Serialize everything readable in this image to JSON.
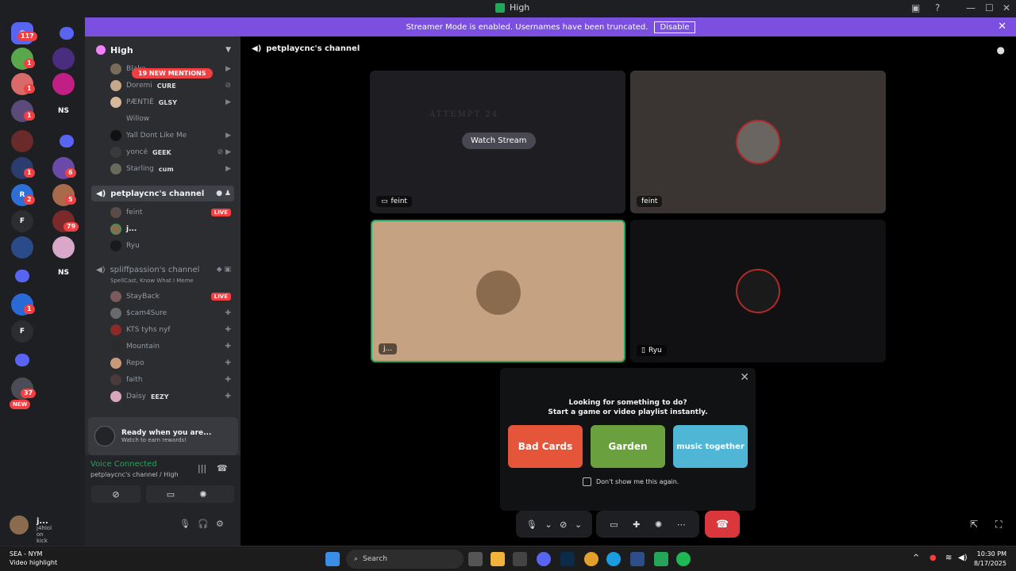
{
  "window": {
    "title": "High"
  },
  "banner": {
    "text": "Streamer Mode is enabled. Usernames have been truncated.",
    "button": "Disable"
  },
  "rail": {
    "badges": {
      "dm": "117",
      "new": "NEW",
      "count37": "37",
      "b1": "1",
      "b6": "6",
      "b5": "5",
      "b2": "2",
      "b79": "79"
    },
    "labels": {
      "ns": "NS",
      "ns2": "NS",
      "ns3": "NS",
      "f": "F",
      "f2": "F",
      "r": "R"
    }
  },
  "guild": {
    "name": "High"
  },
  "channels": {
    "mentions": "19 NEW MENTIONS",
    "top_members": [
      {
        "name": "Blake",
        "tag": ""
      },
      {
        "name": "Doremi",
        "tag": "CURE"
      },
      {
        "name": "PÆNTIÈ",
        "tag": "GLSY"
      },
      {
        "name": "Willow",
        "tag": ""
      },
      {
        "name": "Yall Dont Like Me",
        "tag": ""
      },
      {
        "name": "yoncé",
        "tag": "GEEK"
      },
      {
        "name": "Starling",
        "tag": "cum"
      }
    ],
    "active_channel": "petplaycnc's channel",
    "active_members": [
      {
        "name": "feint",
        "badge": "LIVE"
      },
      {
        "name": "j...",
        "badge": ""
      },
      {
        "name": "Ryu",
        "badge": ""
      }
    ],
    "second_channel": "spliffpassion's channel",
    "second_channel_status": "SpellCast, Know What I Meme",
    "second_members": [
      {
        "name": "StayBack",
        "badge": "LIVE"
      },
      {
        "name": "$cam4Sure",
        "badge": ""
      },
      {
        "name": "KTS tyhs nyf",
        "badge": ""
      },
      {
        "name": "Mountain",
        "badge": ""
      },
      {
        "name": "Repo",
        "badge": ""
      },
      {
        "name": "faith",
        "badge": ""
      },
      {
        "name": "Daisy",
        "tag": "EEZY"
      }
    ]
  },
  "promo": {
    "title": "Ready when you are...",
    "subtitle": "Watch to earn rewards!"
  },
  "voice": {
    "status": "Voice Connected",
    "channel": "petplaycnc's channel / High"
  },
  "user": {
    "name": "j...",
    "status": "j4hlol on kick"
  },
  "main": {
    "channel_title": "petplaycnc's channel",
    "tiles": [
      {
        "label": "feint",
        "watch": "Watch Stream",
        "ghost": "ATTEMPT 24"
      },
      {
        "label": "feint"
      },
      {
        "label": "j..."
      },
      {
        "label": "Ryu"
      }
    ]
  },
  "activity": {
    "line1": "Looking for something to do?",
    "line2": "Start a game or video playlist instantly.",
    "cards": [
      {
        "label": "Bad Cards",
        "color": "#e4553a"
      },
      {
        "label": "Garden",
        "color": "#6aa13e"
      },
      {
        "label": "music together",
        "color": "#4fb6d6"
      }
    ],
    "dont_show": "Don't show me this again."
  },
  "taskbar": {
    "weather_line1": "SEA - NYM",
    "weather_line2": "Video highlight",
    "search": "Search",
    "time": "10:30 PM",
    "date": "8/17/2025"
  },
  "colors": {
    "accent": "#7b4fe0",
    "live": "#f23f42",
    "connected": "#23a55a",
    "speaking": "#23a55a",
    "hangup": "#da373c"
  }
}
